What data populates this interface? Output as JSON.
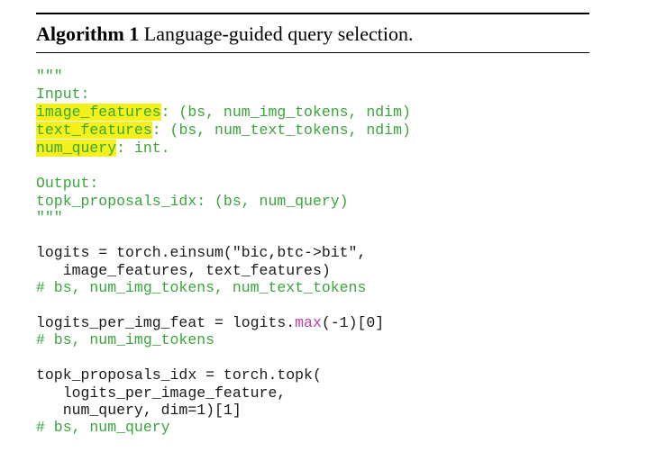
{
  "algorithm": {
    "label": "Algorithm 1",
    "title": "Language-guided query selection."
  },
  "code": {
    "doc_open": "\"\"\"",
    "input_header": "Input:",
    "in1_name": "image_features",
    "in1_rest": ": (bs, num_img_tokens, ndim)",
    "in2_name": "text_features",
    "in2_rest": ": (bs, num_text_tokens, ndim)",
    "in3_name": "num_query",
    "in3_rest": ": int.",
    "output_header": "Output:",
    "out1": "topk_proposals_idx: (bs, num_query)",
    "doc_close": "\"\"\"",
    "logits_line1": "logits = torch.einsum(\"bic,btc->bit\",",
    "logits_line2": "   image_features, text_features)",
    "logits_comment": "# bs, num_img_tokens, num_text_tokens",
    "lpif_prefix": "logits_per_img_feat = logits.",
    "lpif_fn": "max",
    "lpif_suffix": "(-1)[0]",
    "lpif_comment": "# bs, num_img_tokens",
    "topk_line1": "topk_proposals_idx = torch.topk(",
    "topk_line2": "   logits_per_image_feature,",
    "topk_line3": "   num_query, dim=1)[1]",
    "topk_comment": "# bs, num_query"
  },
  "colors": {
    "comment": "#3aa53a",
    "builtin": "#c43fa0",
    "highlight": "#f4f01a"
  }
}
